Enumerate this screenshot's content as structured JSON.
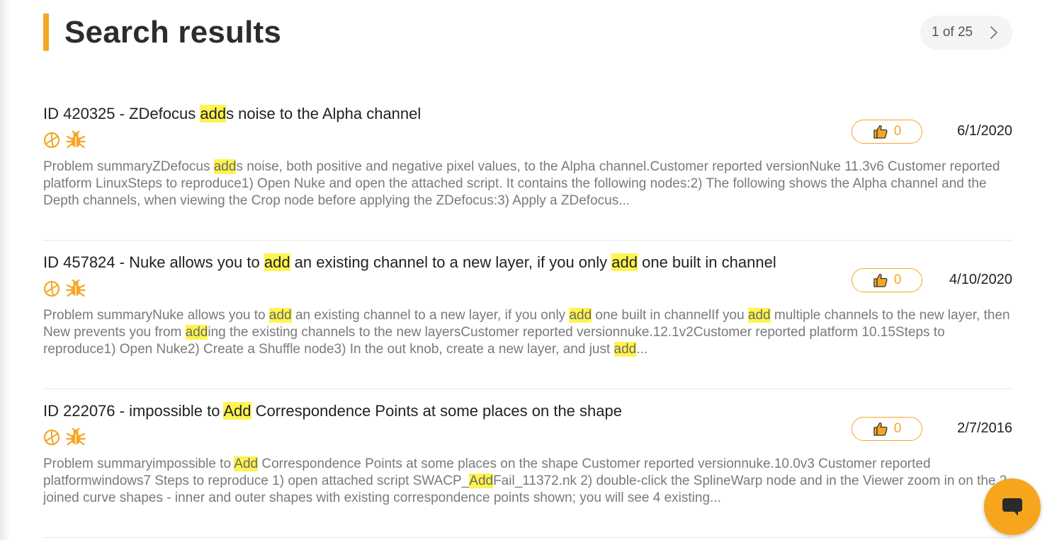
{
  "header": {
    "title": "Search results",
    "pagination": "1 of 25"
  },
  "colors": {
    "accent": "#f5a623",
    "highlight": "#fff44f",
    "chat_button": "#f7a51c"
  },
  "icons": {
    "product": "nuke-logo-icon",
    "issue_type": "bug-icon",
    "like": "thumbs-up-icon",
    "next": "chevron-right-icon",
    "chat": "chat-icon"
  },
  "results": [
    {
      "title_parts": [
        "ID 420325 - ZDefocus ",
        "add",
        "s noise to the Alpha channel"
      ],
      "summary_parts": [
        "Problem summaryZDefocus ",
        "add",
        "s noise, both positive and negative pixel values, to the Alpha channel.Customer reported versionNuke 11.3v6 Customer reported platform LinuxSteps to reproduce1) Open Nuke and open the attached script. It contains the following nodes:2) The following shows the Alpha channel and the Depth channels, when viewing the Crop node before applying the ZDefocus:3) Apply a ZDefocus..."
      ],
      "likes": "0",
      "date": "6/1/2020"
    },
    {
      "title_parts": [
        "ID 457824 - Nuke allows you to ",
        "add",
        " an existing channel to a new layer, if you only ",
        "add",
        " one built in channel"
      ],
      "summary_parts": [
        "Problem summaryNuke allows you to ",
        "add",
        " an existing channel to a new layer, if you only ",
        "add",
        " one built in channelIf you ",
        "add",
        " multiple channels to the new layer, then New prevents you from ",
        "add",
        "ing the existing channels to the new layersCustomer reported versionnuke.12.1v2Customer reported platform 10.15Steps to reproduce1) Open Nuke2) Create a Shuffle node3) In the out knob, create a new layer, and just ",
        "add",
        "..."
      ],
      "likes": "0",
      "date": "4/10/2020"
    },
    {
      "title_parts": [
        "ID 222076 - impossible to ",
        "Add",
        " Correspondence Points at some places on the shape"
      ],
      "summary_parts": [
        "Problem summaryimpossible to ",
        "Add",
        " Correspondence Points at some places on the shape Customer reported versionnuke.10.0v3 Customer reported platformwindows7 Steps to reproduce 1) open attached script SWACP_",
        "Add",
        "Fail_11372.nk 2) double-click the SplineWarp node and in the Viewer zoom in on the 2 joined curve shapes - inner and outer shapes with existing correspondence points shown; you will see 4 existing..."
      ],
      "likes": "0",
      "date": "2/7/2016"
    }
  ]
}
